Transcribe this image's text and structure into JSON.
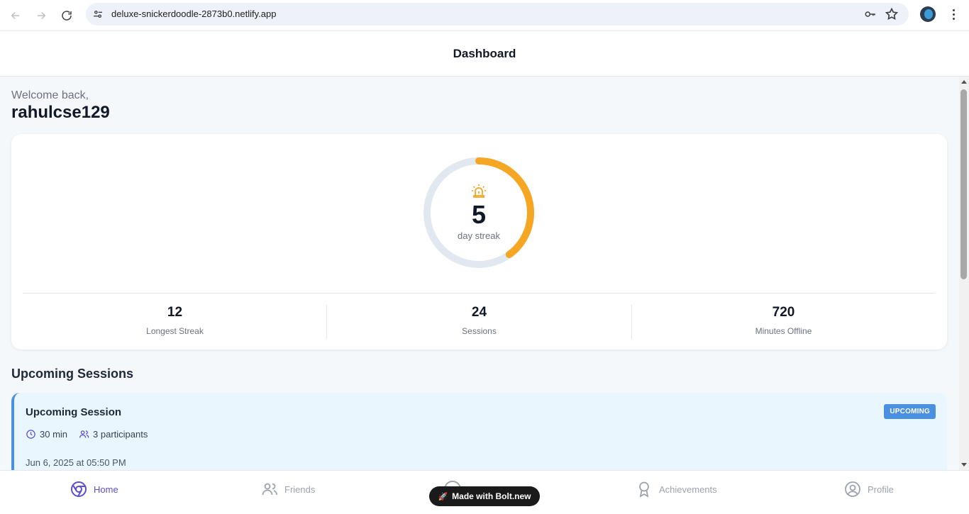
{
  "browser": {
    "url": "deluxe-snickerdoodle-2873b0.netlify.app"
  },
  "header": {
    "title": "Dashboard"
  },
  "welcome": {
    "greeting": "Welcome back,",
    "username": "rahulcse129"
  },
  "streak": {
    "value": "5",
    "label": "day streak",
    "progress_fraction": 0.4,
    "accent_color": "#f5a623",
    "track_color": "#e2e8f0",
    "icon": "alarm-icon"
  },
  "stats": [
    {
      "value": "12",
      "label": "Longest Streak"
    },
    {
      "value": "24",
      "label": "Sessions"
    },
    {
      "value": "720",
      "label": "Minutes Offline"
    }
  ],
  "upcoming": {
    "section_title": "Upcoming Sessions",
    "session": {
      "title": "Upcoming Session",
      "badge": "UPCOMING",
      "duration": "30 min",
      "participants": "3 participants",
      "date": "Jun 6, 2025 at 05:50 PM"
    }
  },
  "bottom_nav": {
    "home": "Home",
    "friends": "Friends",
    "achievements": "Achievements",
    "profile": "Profile",
    "active_color": "#5b4fcf"
  },
  "bolt_badge": {
    "label": "Made with Bolt.new"
  }
}
